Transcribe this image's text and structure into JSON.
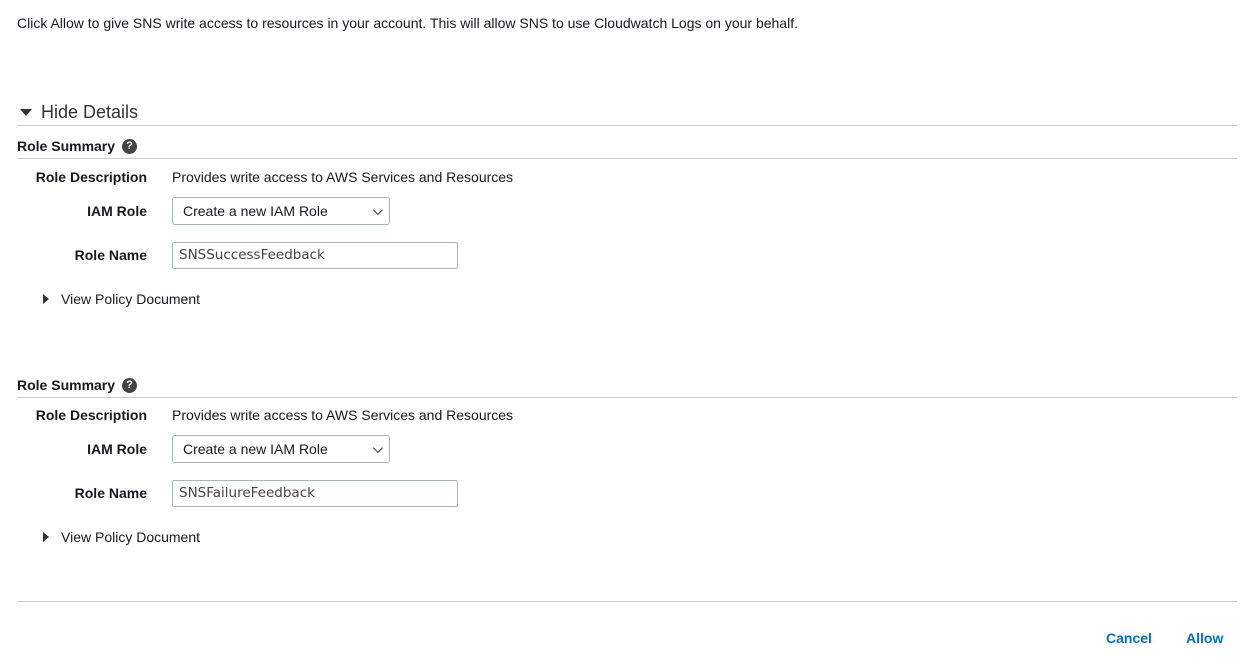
{
  "intro_text": "Click Allow to give SNS write access to resources in your account. This will allow SNS to use Cloudwatch Logs on your behalf.",
  "details_toggle": "Hide Details",
  "sections": [
    {
      "title": "Role Summary",
      "role_description_label": "Role Description",
      "role_description_value": "Provides write access to AWS Services and Resources",
      "iam_role_label": "IAM Role",
      "iam_role_selected": "Create a new IAM Role",
      "role_name_label": "Role Name",
      "role_name_value": "SNSSuccessFeedback",
      "policy_toggle": "View Policy Document"
    },
    {
      "title": "Role Summary",
      "role_description_label": "Role Description",
      "role_description_value": "Provides write access to AWS Services and Resources",
      "iam_role_label": "IAM Role",
      "iam_role_selected": "Create a new IAM Role",
      "role_name_label": "Role Name",
      "role_name_value": "SNSFailureFeedback",
      "policy_toggle": "View Policy Document"
    }
  ],
  "footer": {
    "cancel_label": "Cancel",
    "allow_label": "Allow"
  },
  "colors": {
    "link": "#0073bb",
    "divider": "#c9c9c9"
  },
  "icons": {
    "help": "question-circle-icon",
    "details_expanded": "caret-down-icon",
    "policy_collapsed": "caret-right-icon"
  }
}
